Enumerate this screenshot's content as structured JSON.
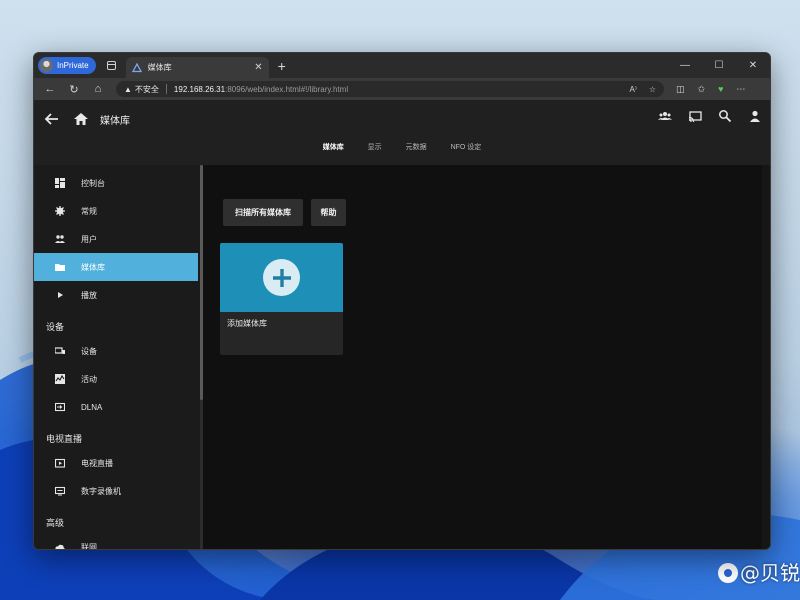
{
  "browser": {
    "inprivate_label": "InPrivate",
    "tab_title": "媒体库",
    "tab_close": "✕",
    "new_tab": "+",
    "window_controls": [
      "—",
      "☐",
      "✕"
    ],
    "security_warning": "不安全",
    "url_host": "192.168.26.31",
    "url_path": ":8096/web/index.html#!/library.html",
    "toolbar_icons": [
      "read-aloud-icon",
      "favorite-icon",
      "split-screen-icon",
      "favorites-icon",
      "browser-essentials-icon",
      "more-icon"
    ]
  },
  "app": {
    "page_title": "媒体库",
    "subtabs": [
      {
        "label": "媒体库",
        "active": true
      },
      {
        "label": "显示",
        "active": false
      },
      {
        "label": "元数据",
        "active": false
      },
      {
        "label": "NFO 设定",
        "active": false
      }
    ],
    "sidebar": {
      "items": [
        {
          "label": "控制台",
          "icon": "dashboard-icon"
        },
        {
          "label": "常规",
          "icon": "gear-icon"
        },
        {
          "label": "用户",
          "icon": "people-icon"
        },
        {
          "label": "媒体库",
          "icon": "folder-icon",
          "active": true
        },
        {
          "label": "播放",
          "icon": "play-icon"
        }
      ],
      "section_devices": "设备",
      "device_items": [
        {
          "label": "设备",
          "icon": "devices-icon"
        },
        {
          "label": "活动",
          "icon": "activity-icon"
        },
        {
          "label": "DLNA",
          "icon": "dlna-icon"
        }
      ],
      "section_livetv": "电视直播",
      "livetv_items": [
        {
          "label": "电视直播",
          "icon": "live-tv-icon"
        },
        {
          "label": "数字录像机",
          "icon": "dvr-icon"
        }
      ],
      "section_advanced": "高级",
      "advanced_items": [
        {
          "label": "联网",
          "icon": "cloud-icon"
        }
      ]
    },
    "actions": {
      "scan_all": "扫描所有媒体库",
      "help": "帮助"
    },
    "add_library_card": {
      "label": "添加媒体库"
    }
  },
  "watermark": "@贝锐",
  "colors": {
    "accent": "#52b0dc",
    "card_blue": "#1e8fb6",
    "inprivate_blue": "#2f69d9"
  }
}
